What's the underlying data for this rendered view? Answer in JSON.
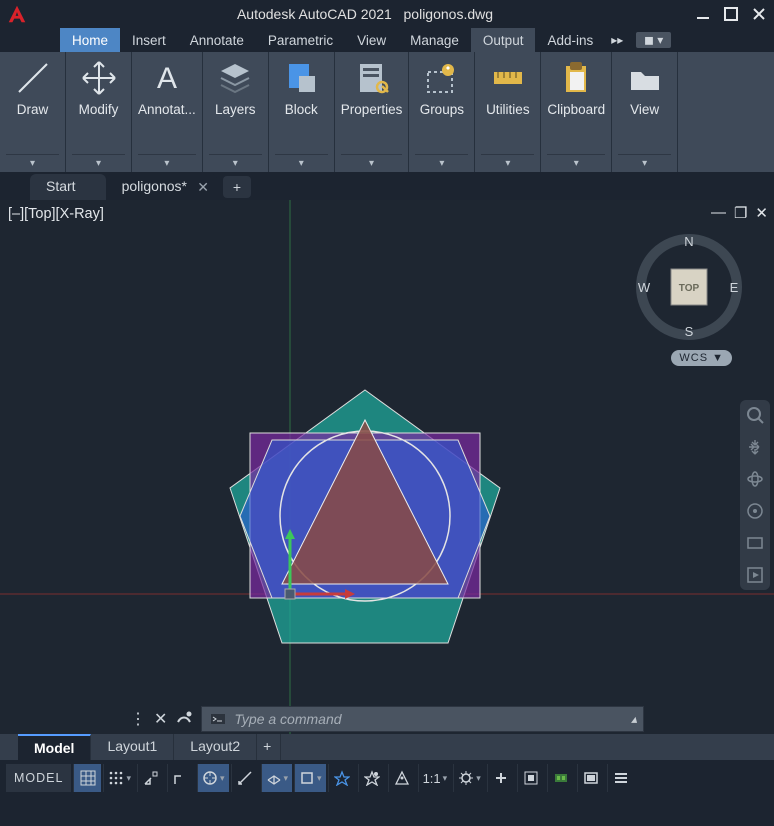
{
  "title": {
    "app": "Autodesk AutoCAD 2021",
    "file": "poligonos.dwg"
  },
  "menubar": {
    "items": [
      "Home",
      "Insert",
      "Annotate",
      "Parametric",
      "View",
      "Manage",
      "Output",
      "Add-ins"
    ],
    "active": "Home",
    "highlighted": "Output"
  },
  "ribbon": {
    "panels": [
      {
        "name": "Draw",
        "icon": "line-icon"
      },
      {
        "name": "Modify",
        "icon": "move-icon"
      },
      {
        "name": "Annotat...",
        "icon": "text-A-icon"
      },
      {
        "name": "Layers",
        "icon": "layers-icon"
      },
      {
        "name": "Block",
        "icon": "block-icon"
      },
      {
        "name": "Properties",
        "icon": "properties-icon"
      },
      {
        "name": "Groups",
        "icon": "groups-icon"
      },
      {
        "name": "Utilities",
        "icon": "measure-icon"
      },
      {
        "name": "Clipboard",
        "icon": "clipboard-icon"
      },
      {
        "name": "View",
        "icon": "folder-icon"
      }
    ]
  },
  "doctabs": {
    "start": "Start",
    "file": "poligonos*",
    "plus": "+"
  },
  "viewport": {
    "label": "[–][Top][X-Ray]",
    "navcube": {
      "n": "N",
      "e": "E",
      "s": "S",
      "w": "W",
      "face": "TOP"
    },
    "wcs": "WCS ▼",
    "navbar_icons": [
      "zoom-extents-icon",
      "pan-icon",
      "orbit-icon",
      "steering-icon",
      "showmotion-icon",
      "play-icon"
    ]
  },
  "command": {
    "placeholder": "Type a command"
  },
  "layouttabs": {
    "tabs": [
      "Model",
      "Layout1",
      "Layout2"
    ],
    "active": "Model",
    "plus": "+"
  },
  "statusbar": {
    "model": "MODEL",
    "scale": "1:1",
    "buttons": [
      "grid-icon",
      "snap-icon",
      "infer-icon",
      "dynamic-icon",
      "ortho-icon",
      "polar-icon",
      "iso-icon",
      "osnap-icon",
      "autosnap-icon",
      "lineweight-icon",
      "transparency-icon",
      "cycle-icon",
      "scale-icon",
      "gear-icon",
      "plus-small-icon",
      "isolate-icon",
      "hardware-icon",
      "clean-icon",
      "menu-icon"
    ]
  }
}
